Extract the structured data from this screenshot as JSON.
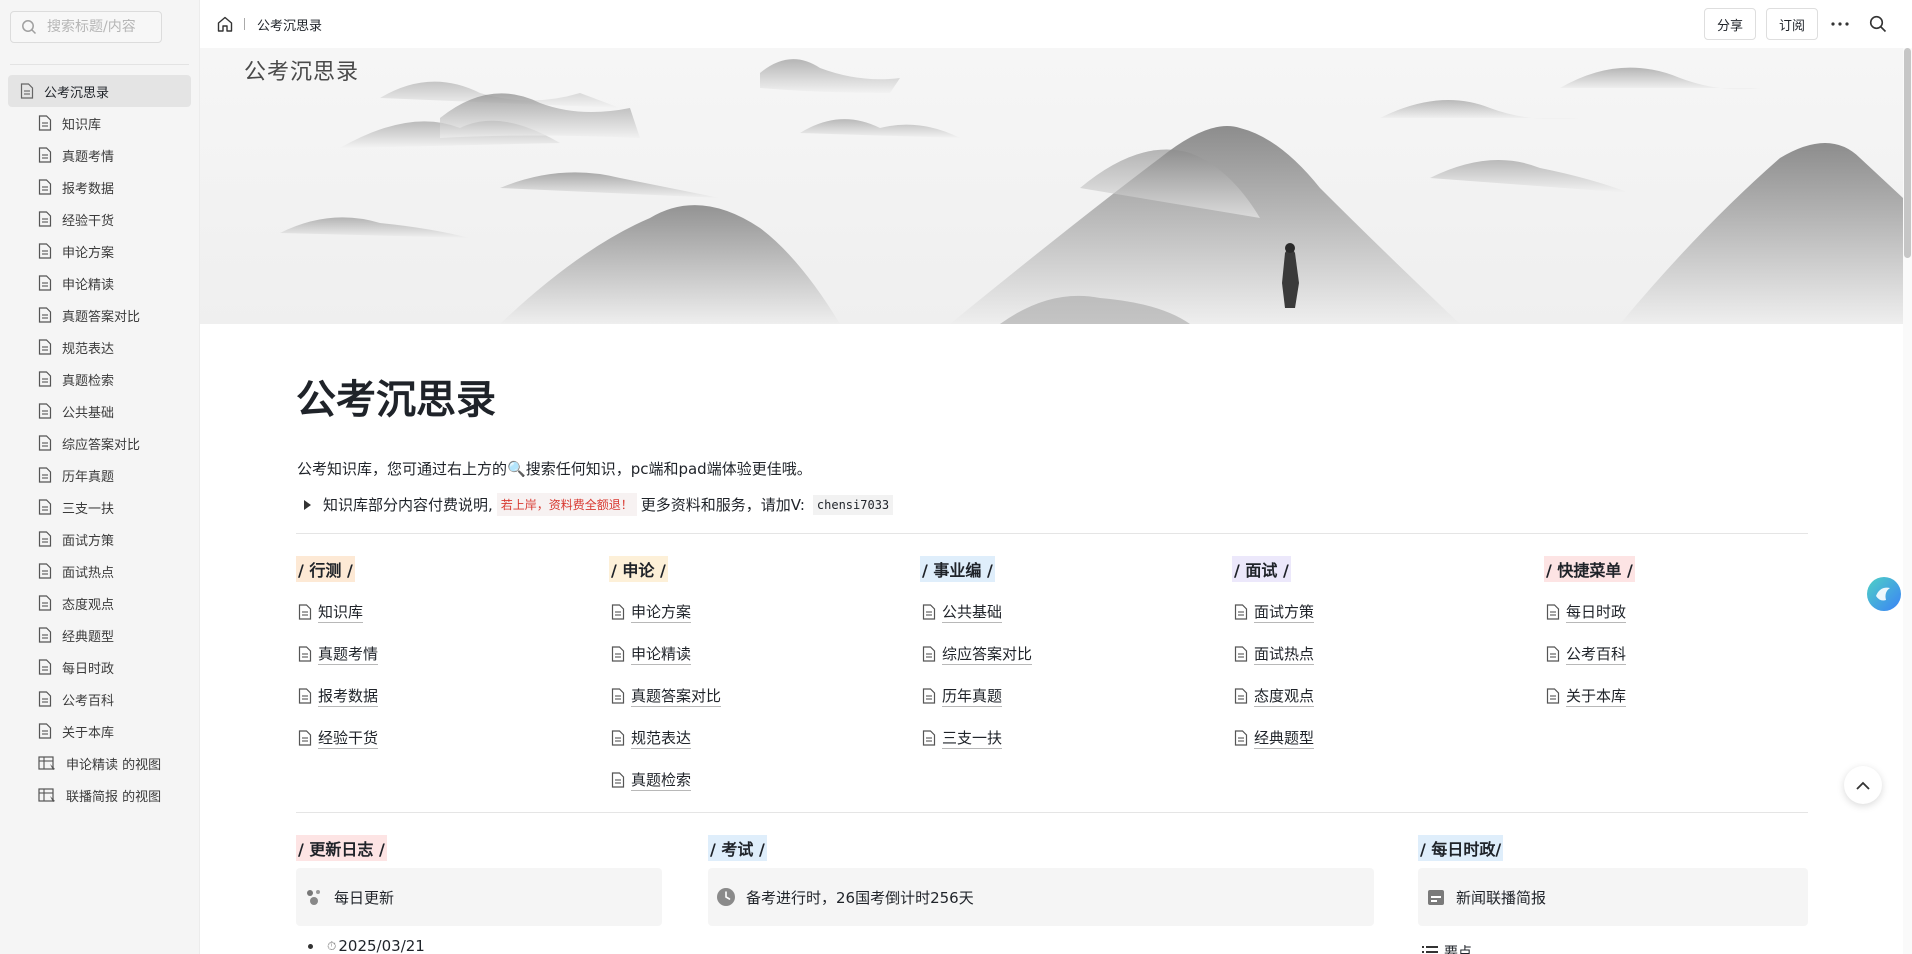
{
  "sidebar": {
    "search_placeholder": "搜索标题/内容",
    "root": "公考沉思录",
    "items": [
      "知识库",
      "真题考情",
      "报考数据",
      "经验干货",
      "申论方案",
      "申论精读",
      "真题答案对比",
      "规范表达",
      "真题检索",
      "公共基础",
      "综应答案对比",
      "历年真题",
      "三支一扶",
      "面试方策",
      "面试热点",
      "态度观点",
      "经典题型",
      "每日时政",
      "公考百科",
      "关于本库"
    ],
    "views": [
      "申论精读 的视图",
      "联播简报 的视图"
    ]
  },
  "topbar": {
    "breadcrumb": "公考沉思录",
    "share_label": "分享",
    "subscribe_label": "订阅"
  },
  "banner": {
    "logo_text": "公考沉思录"
  },
  "page": {
    "title": "公考沉思录",
    "intro_before": "公考知识库，您可通过右上方的",
    "intro_after": "搜索任何知识，pc端和pad端体验更佳哦。",
    "note_text": "知识库部分内容付费说明,",
    "note_red": "若上岸，资料费全额退！",
    "note_more": "更多资料和服务，请加V:",
    "note_code": "chensi7033"
  },
  "columns": [
    {
      "head": "/ 行测 /",
      "color": "#fde9d5",
      "items": [
        "知识库",
        "真题考情",
        "报考数据",
        "经验干货"
      ]
    },
    {
      "head": "/ 申论 /",
      "color": "#fdf0d8",
      "items": [
        "申论方案",
        "申论精读",
        "真题答案对比",
        "规范表达",
        "真题检索"
      ]
    },
    {
      "head": "/ 事业编 /",
      "color": "#dfeefb",
      "items": [
        "公共基础",
        "综应答案对比",
        "历年真题",
        "三支一扶"
      ]
    },
    {
      "head": "/ 面试 /",
      "color": "#ece8fb",
      "items": [
        "面试方策",
        "面试热点",
        "态度观点",
        "经典题型"
      ]
    },
    {
      "head": "/ 快捷菜单 /",
      "color": "#fde4e4",
      "items": [
        "每日时政",
        "公考百科",
        "关于本库"
      ]
    }
  ],
  "sections": {
    "log_head": "/ 更新日志 /",
    "log_card": "每日更新",
    "log_bullet": "2025/03/21",
    "exam_head": "/ 考试 /",
    "exam_card": "备考进行时，26国考倒计时256天",
    "politics_head": "/ 每日时政/",
    "politics_card": "新闻联播简报",
    "politics_bullet": "要点"
  },
  "colors": {
    "sidebar_bg": "#f5f5f5",
    "selected_bg": "#e4e4e4",
    "log_head_bg": "#fde4e4",
    "exam_head_bg": "#dfeefb",
    "politics_head_bg": "#dfeefb"
  }
}
